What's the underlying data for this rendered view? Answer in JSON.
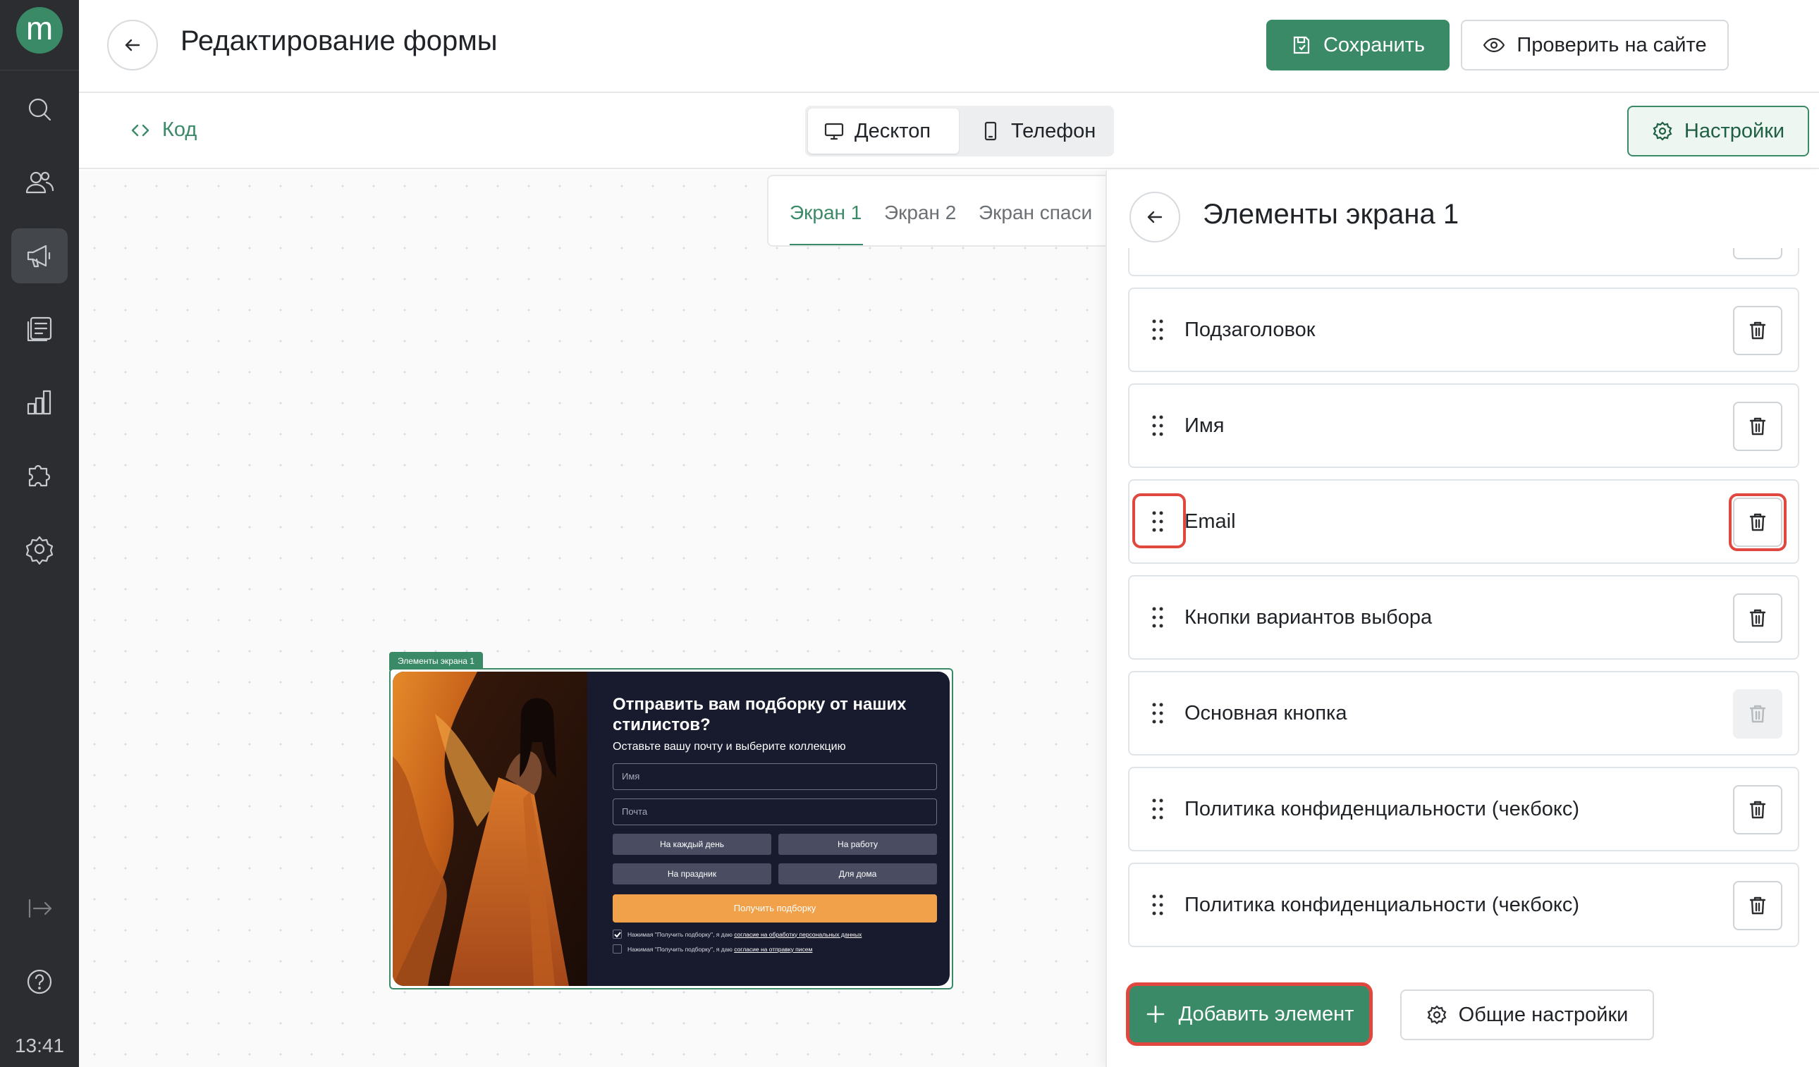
{
  "app": {
    "logo_letter": "m",
    "time": "13:41",
    "accent_color": "#3a8a67",
    "highlight_color": "#e0483f"
  },
  "rail": {
    "icons": [
      "search-icon",
      "users-icon",
      "megaphone-icon",
      "forms-icon",
      "chart-icon",
      "puzzle-icon",
      "gear-icon",
      "collapse-icon",
      "help-icon"
    ]
  },
  "header": {
    "title": "Редактирование формы",
    "save_label": "Сохранить",
    "check_label": "Проверить на сайте"
  },
  "subbar": {
    "code_label": "Код",
    "desktop_label": "Десктоп",
    "phone_label": "Телефон",
    "active_device": "Десктоп",
    "settings_label": "Настройки"
  },
  "screens": {
    "tabs": [
      "Экран 1",
      "Экран 2",
      "Экран спаси"
    ],
    "active": "Экран 1"
  },
  "preview": {
    "label": "Элементы экрана 1",
    "title": "Отправить вам подборку от наших стилистов?",
    "subtitle": "Оставьте вашу почту и выберите коллекцию",
    "name_placeholder": "Имя",
    "email_placeholder": "Почта",
    "choices": [
      "На каждый день",
      "На работу",
      "На праздник",
      "Для дома"
    ],
    "submit_label": "Получить подборку",
    "consent1_text": "Нажимая \"Получить подборку\", я даю ",
    "consent1_link": "согласие на обработку персональных данных",
    "consent1_checked": true,
    "consent2_text": "Нажимая \"Получить подборку\", я даю ",
    "consent2_link": "согласие на отправку писем",
    "consent2_checked": false
  },
  "panel": {
    "title": "Элементы экрана 1",
    "elements": [
      {
        "label": "",
        "delete_enabled": true
      },
      {
        "label": "Подзаголовок",
        "delete_enabled": true
      },
      {
        "label": "Имя",
        "delete_enabled": true
      },
      {
        "label": "Email",
        "delete_enabled": true,
        "highlighted": true
      },
      {
        "label": "Кнопки вариантов выбора",
        "delete_enabled": true
      },
      {
        "label": "Основная кнопка",
        "delete_enabled": false
      },
      {
        "label": "Политика конфиденциальности (чекбокс)",
        "delete_enabled": true
      },
      {
        "label": "Политика конфиденциальности (чекбокс)",
        "delete_enabled": true
      }
    ],
    "add_label": "Добавить элемент",
    "general_label": "Общие настройки"
  }
}
